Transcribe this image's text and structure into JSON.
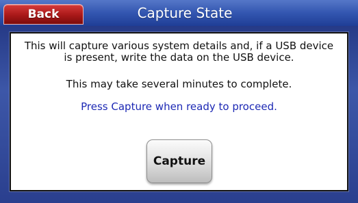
{
  "header": {
    "back_label": "Back",
    "title": "Capture State"
  },
  "panel": {
    "description": "This will capture various system details and, if a USB device is present, write the data on the USB device.",
    "duration_note": "This may take several minutes to complete.",
    "instruction": "Press Capture when ready to proceed.",
    "capture_label": "Capture"
  },
  "colors": {
    "back_button": "#a81818",
    "title_bar": "#3356b0",
    "instruction_text": "#1c28b4",
    "background": "#2a3f8e"
  }
}
